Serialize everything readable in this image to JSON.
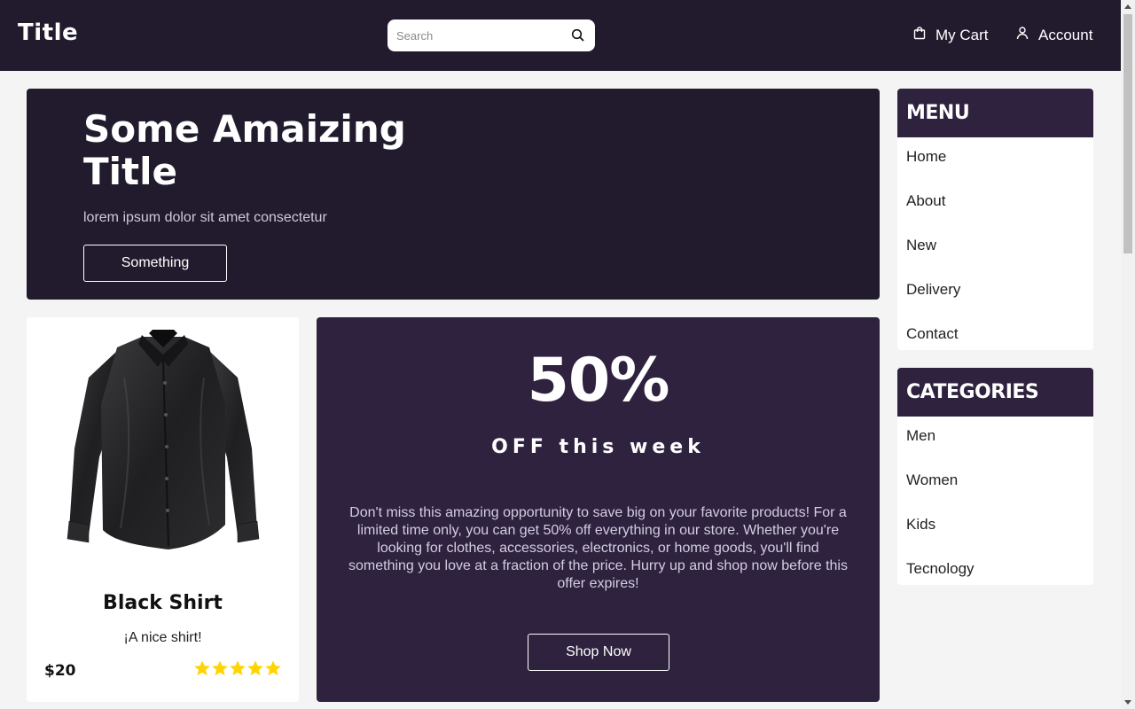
{
  "header": {
    "logo": "Title",
    "search_placeholder": "Search",
    "cart_label": "My Cart",
    "account_label": "Account"
  },
  "hero": {
    "title": "Some Amaizing Title",
    "subtitle": "lorem ipsum dolor sit amet consectetur",
    "button": "Something"
  },
  "product": {
    "name": "Black Shirt",
    "description": "¡A nice shirt!",
    "price": "$20",
    "rating": 5,
    "rating_max": 5
  },
  "promo": {
    "headline": "50%",
    "subheadline": "OFF this week",
    "text": "Don't miss this amazing opportunity to save big on your favorite products! For a limited time only, you can get 50% off everything in our store. Whether you're looking for clothes, accessories, electronics, or home goods, you'll find something you love at a fraction of the price. Hurry up and shop now before this offer expires!",
    "button": "Shop Now"
  },
  "menu": {
    "title": "MENU",
    "items": [
      "Home",
      "About",
      "New",
      "Delivery",
      "Contact"
    ]
  },
  "categories": {
    "title": "CATEGORIES",
    "items": [
      "Men",
      "Women",
      "Kids",
      "Tecnology"
    ]
  },
  "colors": {
    "header_bg": "#221b2e",
    "panel_bg": "#2e223f",
    "page_bg": "#f4f4f4",
    "star": "#ffd400"
  },
  "icons": {
    "search": "search-icon",
    "cart": "shopping-bag-icon",
    "account": "user-icon",
    "star": "star-icon"
  }
}
